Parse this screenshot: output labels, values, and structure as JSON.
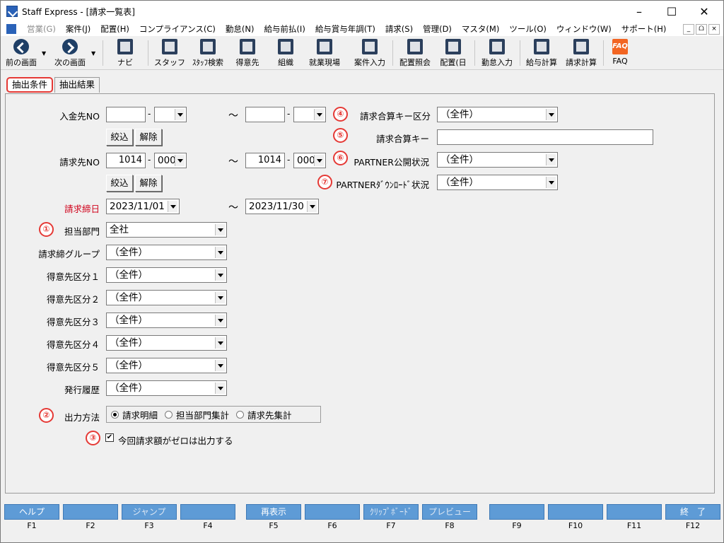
{
  "window": {
    "title": "Staff Express - [請求一覧表]",
    "min": "–",
    "max": "☐",
    "close": "✕"
  },
  "menubar": {
    "items": [
      {
        "label": "営業(G)",
        "disabled": true
      },
      {
        "label": "案件(J)"
      },
      {
        "label": "配置(H)"
      },
      {
        "label": "コンプライアンス(C)"
      },
      {
        "label": "勤怠(N)"
      },
      {
        "label": "給与前払(I)"
      },
      {
        "label": "給与賞与年調(T)"
      },
      {
        "label": "請求(S)"
      },
      {
        "label": "管理(D)"
      },
      {
        "label": "マスタ(M)"
      },
      {
        "label": "ツール(O)"
      },
      {
        "label": "ウィンドウ(W)"
      },
      {
        "label": "サポート(H)"
      }
    ],
    "mdi": {
      "min": "_",
      "restore": "ᗝ",
      "close": "×"
    }
  },
  "toolbar": {
    "items": [
      {
        "label": "前の画面",
        "icon": "back-arrow-icon"
      },
      {
        "label": "次の画面",
        "icon": "forward-arrow-icon"
      },
      {
        "label": "ナビ",
        "icon": "keyboard-icon"
      },
      {
        "label": "スタッフ",
        "icon": "staff-icon"
      },
      {
        "label": "ｽﾀｯﾌ検索",
        "icon": "staff-search-icon"
      },
      {
        "label": "得意先",
        "icon": "customer-icon"
      },
      {
        "label": "組織",
        "icon": "organization-icon"
      },
      {
        "label": "就業現場",
        "icon": "worksite-icon"
      },
      {
        "label": "案件入力",
        "icon": "job-entry-icon"
      },
      {
        "label": "配置照会",
        "icon": "placement-inquiry-icon"
      },
      {
        "label": "配置(日",
        "icon": "placement-daily-icon"
      },
      {
        "label": "勤怠入力",
        "icon": "attendance-entry-icon"
      },
      {
        "label": "給与計算",
        "icon": "payroll-icon"
      },
      {
        "label": "請求計算",
        "icon": "billing-calc-icon"
      },
      {
        "label": "FAQ",
        "icon": "faq-icon",
        "icon_text": "FAQ"
      }
    ]
  },
  "tabs": [
    {
      "label": "抽出条件"
    },
    {
      "label": "抽出結果"
    }
  ],
  "form": {
    "nyukin": {
      "label": "入金先NO",
      "from_code": "",
      "from_sub": "",
      "to_code": "",
      "to_sub": ""
    },
    "seikyu": {
      "label": "請求先NO",
      "from_code": "1014",
      "from_sub": "000",
      "to_code": "1014",
      "to_sub": "000"
    },
    "shime": {
      "label": "請求締日",
      "from": "2023/11/01",
      "to": "2023/11/30"
    },
    "filter_btn": "絞込",
    "clear_btn": "解除",
    "dash": "-",
    "tilde": "～",
    "tanto": {
      "label": "担当部門",
      "value": "全社"
    },
    "shime_group": {
      "label": "請求締グループ",
      "value": "（全件）"
    },
    "tokui1": {
      "label": "得意先区分１",
      "value": "（全件）"
    },
    "tokui2": {
      "label": "得意先区分２",
      "value": "（全件）"
    },
    "tokui3": {
      "label": "得意先区分３",
      "value": "（全件）"
    },
    "tokui4": {
      "label": "得意先区分４",
      "value": "（全件）"
    },
    "tokui5": {
      "label": "得意先区分５",
      "value": "（全件）"
    },
    "hakko": {
      "label": "発行履歴",
      "value": "（全件）"
    },
    "output": {
      "label": "出力方法",
      "options": [
        "請求明細",
        "担当部門集計",
        "請求先集計"
      ],
      "selected": 0
    },
    "zero": {
      "label": "今回請求額がゼロは出力する",
      "checked": true
    },
    "gassan_kubun": {
      "label": "請求合算キー区分",
      "value": "（全件）"
    },
    "gassan_key": {
      "label": "請求合算キー",
      "value": ""
    },
    "partner_kokai": {
      "label": "PARTNER公開状況",
      "value": "（全件）"
    },
    "partner_dl": {
      "label": "PARTNERﾀﾞｳﾝﾛｰﾄﾞ状況",
      "value": "（全件）"
    }
  },
  "badges": [
    "①",
    "②",
    "③",
    "④",
    "⑤",
    "⑥",
    "⑦"
  ],
  "fkeys": [
    {
      "label": "ヘルプ",
      "key": "F1"
    },
    {
      "label": "",
      "key": "F2"
    },
    {
      "label": "ジャンプ",
      "key": "F3",
      "disabled": true
    },
    {
      "label": "",
      "key": "F4"
    },
    {
      "label": "再表示",
      "key": "F5"
    },
    {
      "label": "",
      "key": "F6"
    },
    {
      "label": "ｸﾘｯﾌﾟﾎﾞｰﾄﾞ",
      "key": "F7",
      "disabled": true
    },
    {
      "label": "プレビュー",
      "key": "F8",
      "disabled": true
    },
    {
      "label": "",
      "key": "F9"
    },
    {
      "label": "",
      "key": "F10"
    },
    {
      "label": "",
      "key": "F11"
    },
    {
      "label": "終　了",
      "key": "F12"
    }
  ]
}
